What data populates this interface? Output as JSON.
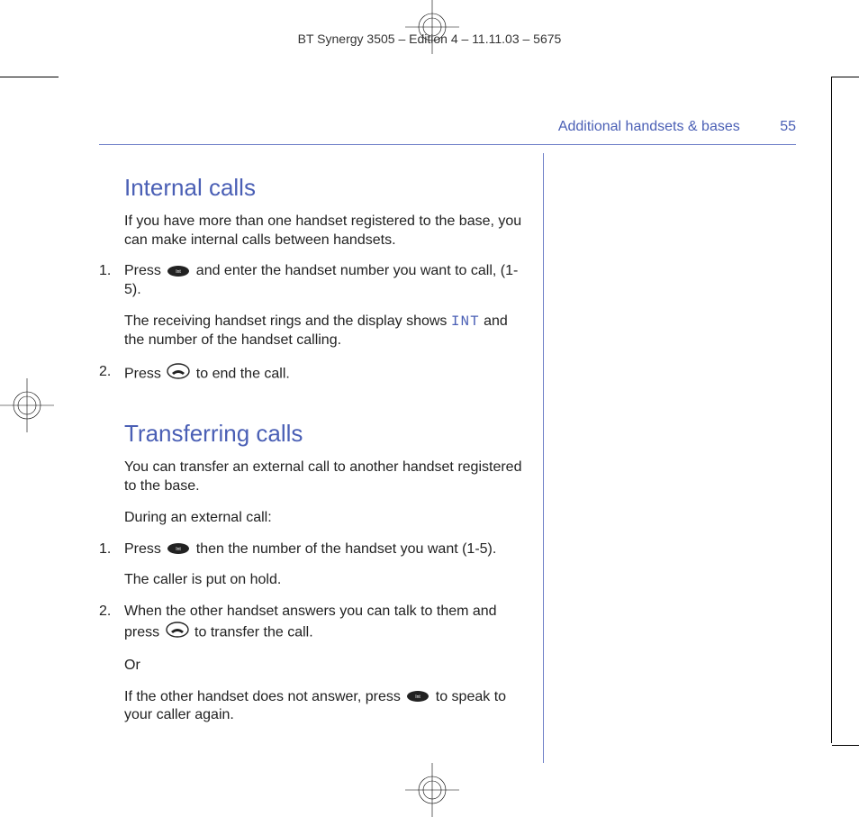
{
  "doc_header": "BT Synergy 3505 – Edition 4 – 11.11.03 – 5675",
  "running_head": {
    "section": "Additional handsets & bases",
    "page": "55"
  },
  "section1": {
    "title": "Internal calls",
    "intro": "If you have more than one handset registered to the base, you can make internal calls between handsets.",
    "step1_num": "1.",
    "step1_a": "Press ",
    "step1_b": " and enter the handset number you want to call, (1-5).",
    "step1_note_a": "The receiving handset rings and the display shows ",
    "step1_code": "INT",
    "step1_note_b": " and the number of the handset calling.",
    "step2_num": "2.",
    "step2_a": "Press ",
    "step2_b": " to end the call."
  },
  "section2": {
    "title": "Transferring calls",
    "intro1": "You can transfer an external call to another handset registered to the base.",
    "intro2": "During an external call:",
    "step1_num": "1.",
    "step1_a": "Press ",
    "step1_b": " then the number of the handset you want (1-5).",
    "step1_note": "The caller is put on hold.",
    "step2_num": "2.",
    "step2_a": "When the other handset answers you can talk to them and press ",
    "step2_b": " to transfer the call.",
    "step2_or": "Or",
    "step2_else_a": "If the other handset does not answer, press ",
    "step2_else_b": " to speak to your caller again."
  },
  "icons": {
    "int_label": "Int"
  }
}
